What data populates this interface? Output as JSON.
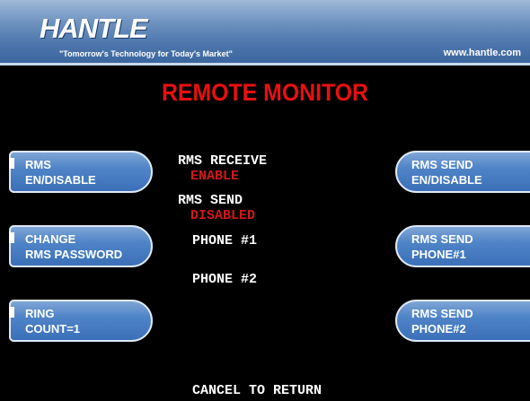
{
  "header": {
    "logo": "HANTLE",
    "tagline": "\"Tomorrow's Technology for Today's Market\"",
    "url": "www.hantle.com"
  },
  "screen_title": "REMOTE MONITOR",
  "left_buttons": [
    {
      "line1": "RMS",
      "line2": "EN/DISABLE"
    },
    {
      "line1": "CHANGE",
      "line2": "RMS PASSWORD"
    },
    {
      "line1": "RING",
      "line2": "COUNT=1"
    }
  ],
  "right_buttons": [
    {
      "line1": "RMS SEND",
      "line2": "EN/DISABLE"
    },
    {
      "line1": "RMS SEND",
      "line2": "PHONE#1"
    },
    {
      "line1": "RMS SEND",
      "line2": "PHONE#2"
    }
  ],
  "status": {
    "receive_label": "RMS RECEIVE",
    "receive_value": "ENABLE",
    "send_label": "RMS SEND",
    "send_value": "DISABLED",
    "phone1_label": "PHONE #1",
    "phone2_label": "PHONE #2"
  },
  "footer": "CANCEL TO RETURN",
  "colors": {
    "background": "#000000",
    "title": "#e81010",
    "status_value": "#d01818",
    "button": "#4f84c8"
  }
}
